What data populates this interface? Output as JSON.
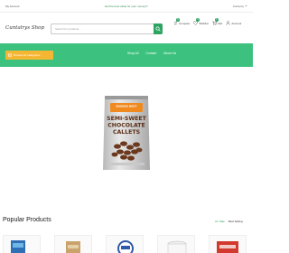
{
  "topbar": {
    "left": "My Account",
    "center": "Get the best value for your money!!!",
    "right": "Currency"
  },
  "header": {
    "logo": "Cuntalrys Shop",
    "search_placeholder": "Search for products..."
  },
  "header_actions": [
    {
      "label": "Compare",
      "count": "0",
      "icon": "compare-icon"
    },
    {
      "label": "Wishlist",
      "count": "0",
      "icon": "heart-icon"
    },
    {
      "label": "Cart",
      "count": "0",
      "icon": "cart-icon"
    },
    {
      "label": "Account",
      "icon": "user-icon"
    }
  ],
  "nav": {
    "browse_label": "Browse All Categories",
    "links": [
      "Shop All",
      "Contact",
      "About Us"
    ]
  },
  "hero": {
    "product_brand": "BAKERS BEST",
    "product_name_line1": "SEMI-SWEET",
    "product_name_line2": "CHOCOLATE",
    "product_name_line3": "CALLETS"
  },
  "popular": {
    "title": "Popular Products",
    "tabs": [
      "On Sale",
      "Best Selling"
    ]
  },
  "colors": {
    "accent_green": "#3cc27e",
    "button_green": "#2ea463",
    "browse_yellow": "#f5b733"
  }
}
